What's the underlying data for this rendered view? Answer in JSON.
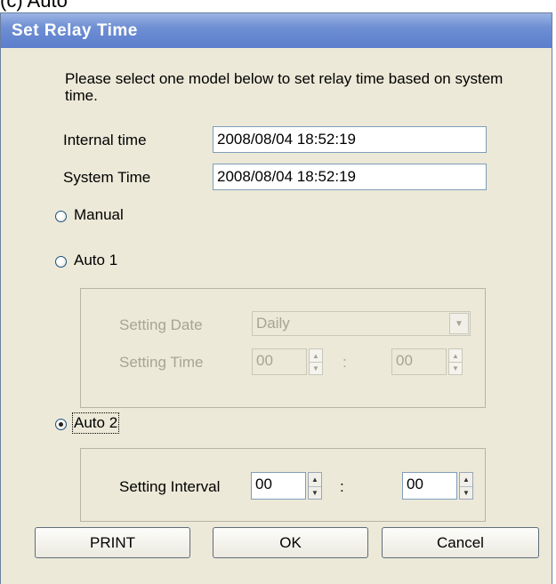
{
  "caption": "(c)  Auto",
  "window": {
    "title": "Set Relay Time"
  },
  "description": "Please select one model below to set relay time based on system time.",
  "internal_time": {
    "label": "Internal time",
    "value": "2008/08/04 18:52:19"
  },
  "system_time": {
    "label": "System Time",
    "value": "2008/08/04 18:52:19"
  },
  "modes": {
    "manual": {
      "label": "Manual",
      "selected": false
    },
    "auto1": {
      "label": "Auto 1",
      "selected": false
    },
    "auto2": {
      "label": "Auto 2",
      "selected": true
    }
  },
  "auto1": {
    "setting_date_label": "Setting Date",
    "setting_date_value": "Daily",
    "setting_time_label": "Setting Time",
    "hour": "00",
    "separator": ":",
    "minute": "00"
  },
  "auto2": {
    "setting_interval_label": "Setting Interval",
    "hour": "00",
    "separator": ":",
    "minute": "00"
  },
  "buttons": {
    "print": "PRINT",
    "ok": "OK",
    "cancel": "Cancel"
  },
  "icons": {
    "dropdown": "chevron-down-icon",
    "spin_up": "triangle-up-icon",
    "spin_down": "triangle-down-icon"
  }
}
